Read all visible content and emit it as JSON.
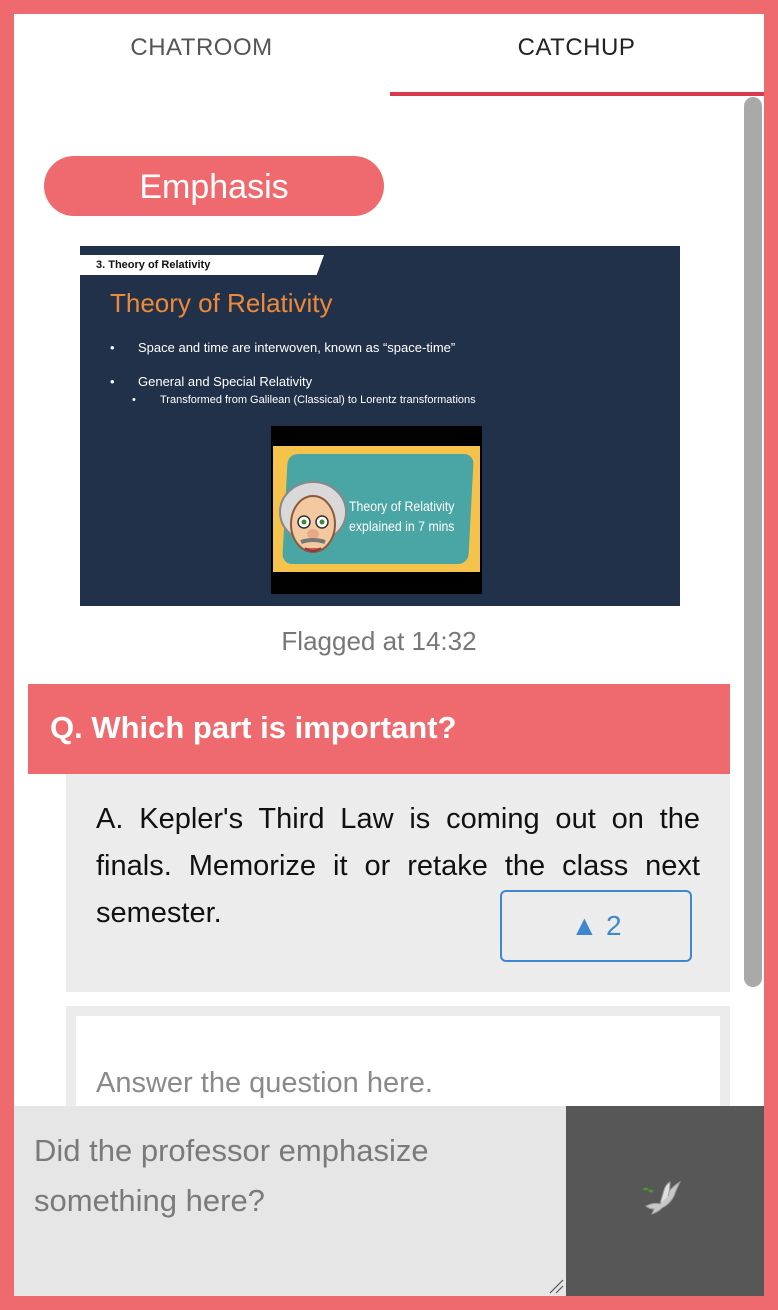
{
  "tabs": [
    {
      "label": "CHATROOM",
      "active": false
    },
    {
      "label": "CATCHUP",
      "active": true
    }
  ],
  "card": {
    "tag": "Emphasis",
    "slide": {
      "section_tag": "3. Theory of Relativity",
      "title": "Theory of Relativity",
      "bullet_1": "Space and time are interwoven, known as “space-time”",
      "bullet_2": "General and Special Relativity",
      "sub_bullet": "Transformed from Galilean (Classical) to Lorentz transformations",
      "video_line_1": "Theory of Relativity",
      "video_line_2": "explained in 7 mins"
    },
    "flagged_at": "Flagged at 14:32"
  },
  "qa": {
    "question": "Q. Which part is important?",
    "answer": "A. Kepler's Third Law is coming out on the finals. Memorize it or retake the class next semester.",
    "upvote_label": "▲ 2",
    "upvote_count": 2,
    "reply_placeholder": "Answer the question here."
  },
  "composer": {
    "placeholder": "Did the professor emphasize something here?",
    "send_icon": "dove-icon"
  },
  "colors": {
    "brand": "#ef6a6e",
    "tab_underline": "#d93a4e",
    "upvote": "#3e87cf",
    "send_button": "#575757"
  }
}
